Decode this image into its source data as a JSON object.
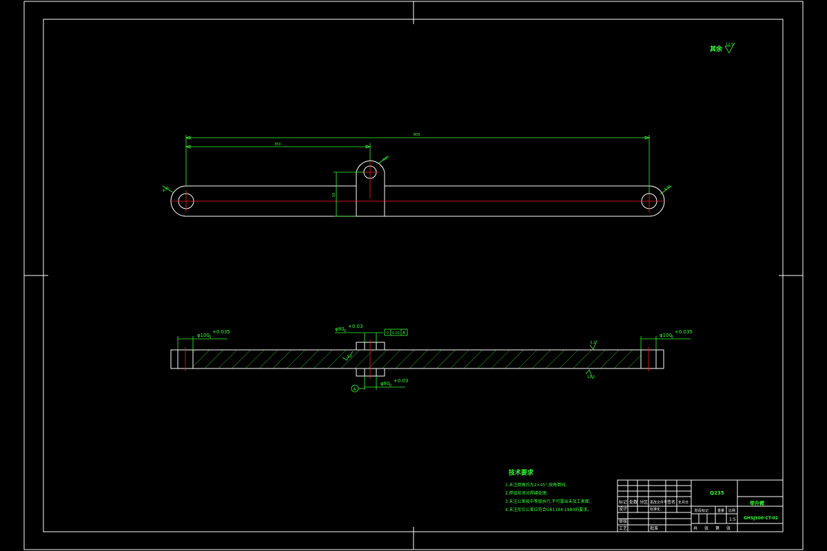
{
  "roughness_note": {
    "label": "其余",
    "value": "12.5"
  },
  "dimensions": {
    "total_length": "800",
    "center_offset": "350",
    "lug_height": "50",
    "end_radius_left": "R30",
    "end_radius_right": "R30",
    "lug_radius": "R25"
  },
  "fits": {
    "left_bore": "φ100",
    "left_bore_tol": "+0.035",
    "center_bore_top": "φ80",
    "center_bore_top_tol": "+0.03",
    "center_bore_bottom": "φ80",
    "center_bore_bottom_tol": "+0.03",
    "right_bore": "φ100",
    "right_bore_tol": "+0.035",
    "zero_subscript": "0"
  },
  "tolerance_frame": {
    "symbol": "⌭",
    "value": "0.01",
    "datum": "A"
  },
  "datum_label": "A",
  "section_roughness": {
    "top": "3.2",
    "bottom": "12.5",
    "side": "3.2"
  },
  "tech_requirements": {
    "title": "技术要求",
    "items": [
      "1.未注倒角均为2×45°,锐角倒钝;",
      "2.焊接前须对焊缝处理;",
      "3.未注公差按中等级执行,不可露出未加工表面;",
      "4.未注形位公差应符合GB1184-1980的要求。"
    ]
  },
  "title_block": {
    "material": "Q235",
    "part_name": "举升臂",
    "drawing_number": "GHSJ500-CT-02",
    "scale": "1:5",
    "grid_labels": [
      "标记",
      "处数",
      "分区",
      "更改文件号",
      "签名",
      "年月日"
    ],
    "stage_label": "阶段标记",
    "weight_label": "重量",
    "scale_label": "比例",
    "sheet_labels": [
      "共",
      "张",
      "第",
      "张"
    ],
    "design_label": "设计",
    "standard_label": "标准化",
    "review_label": "审核",
    "process_label": "工艺",
    "approve_label": "批准"
  }
}
